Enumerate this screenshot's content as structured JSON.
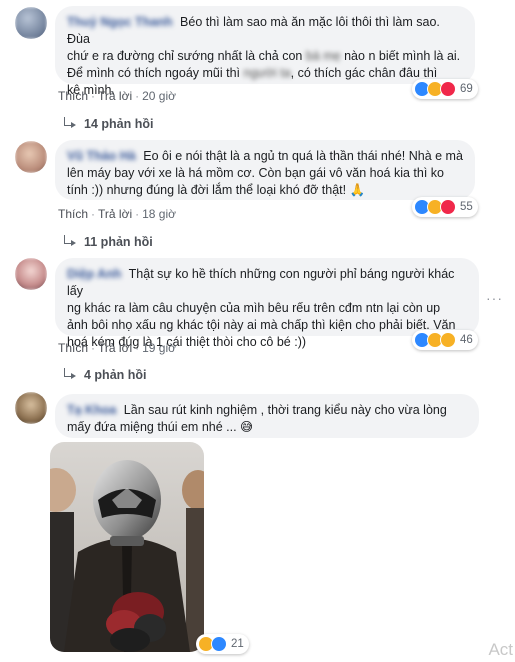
{
  "comments": [
    {
      "author": "Thuỷ Ngọc Thanh",
      "line1": "Béo thì làm sao mà ăn mặc lôi thôi thì làm sao. Đùa",
      "line2_a": "chứ e ra đường chỉ sướng nhất là chả con",
      "line2_redact": "bà mẹ",
      "line2_b": "nào n biết mình là ai.",
      "line3_a": "Để mình có thích ngoáy mũi thì",
      "line3_redact": "người ta",
      "line3_b": ", có thích gác chân đâu thì",
      "line4": "kệ mình.",
      "like": "Thích",
      "reply": "Trả lời",
      "time": "20 giờ",
      "reaction_count": "69",
      "replies": "14 phản hồi"
    },
    {
      "author": "Vũ Thảo Hà",
      "line1": "Eo ôi e nói thật là a ngủ tn quá là thần thái nhé! Nhà e mà",
      "line2": "lên máy bay với xe là há mồm cơ. Còn bạn gái vô văn hoá kia thì ko",
      "line3": "tính :)) nhưng đúng là đời lắm thể loại khó đỡ thật! 🙏",
      "like": "Thích",
      "reply": "Trả lời",
      "time": "18 giờ",
      "reaction_count": "55",
      "replies": "11 phản hồi"
    },
    {
      "author": "Diệp Anh",
      "line1": "Thật sự ko hề thích những con người phỉ báng người khác lấy",
      "line2": "ng khác ra làm câu chuyện của mìh bêu rếu trên cđm ntn lại còn up",
      "line3": "ảnh bôi nhọ xấu ng khác tội này ai mà chấp thì kiện cho phải biết. Văn",
      "line4": "hoá kém đúg là 1 cái thiệt thòi cho cô bé :))",
      "like": "Thích",
      "reply": "Trả lời",
      "time": "19 giờ",
      "reaction_count": "46",
      "replies": "4 phản hồi",
      "more": "···"
    },
    {
      "author": "Tạ Khoa",
      "line1": "Lần sau rút kinh nghiệm , thời trang kiểu này cho vừa lòng",
      "line2": "mấy đứa miệng thúi em nhé ... 😅",
      "reaction_count": "21"
    }
  ],
  "watermark": "Act",
  "colors": {
    "bubble": "#f2f3f5",
    "author": "#385898",
    "like_blue": "#2d88ff",
    "haha_yellow": "#f7b125",
    "love_red": "#f0284a"
  }
}
